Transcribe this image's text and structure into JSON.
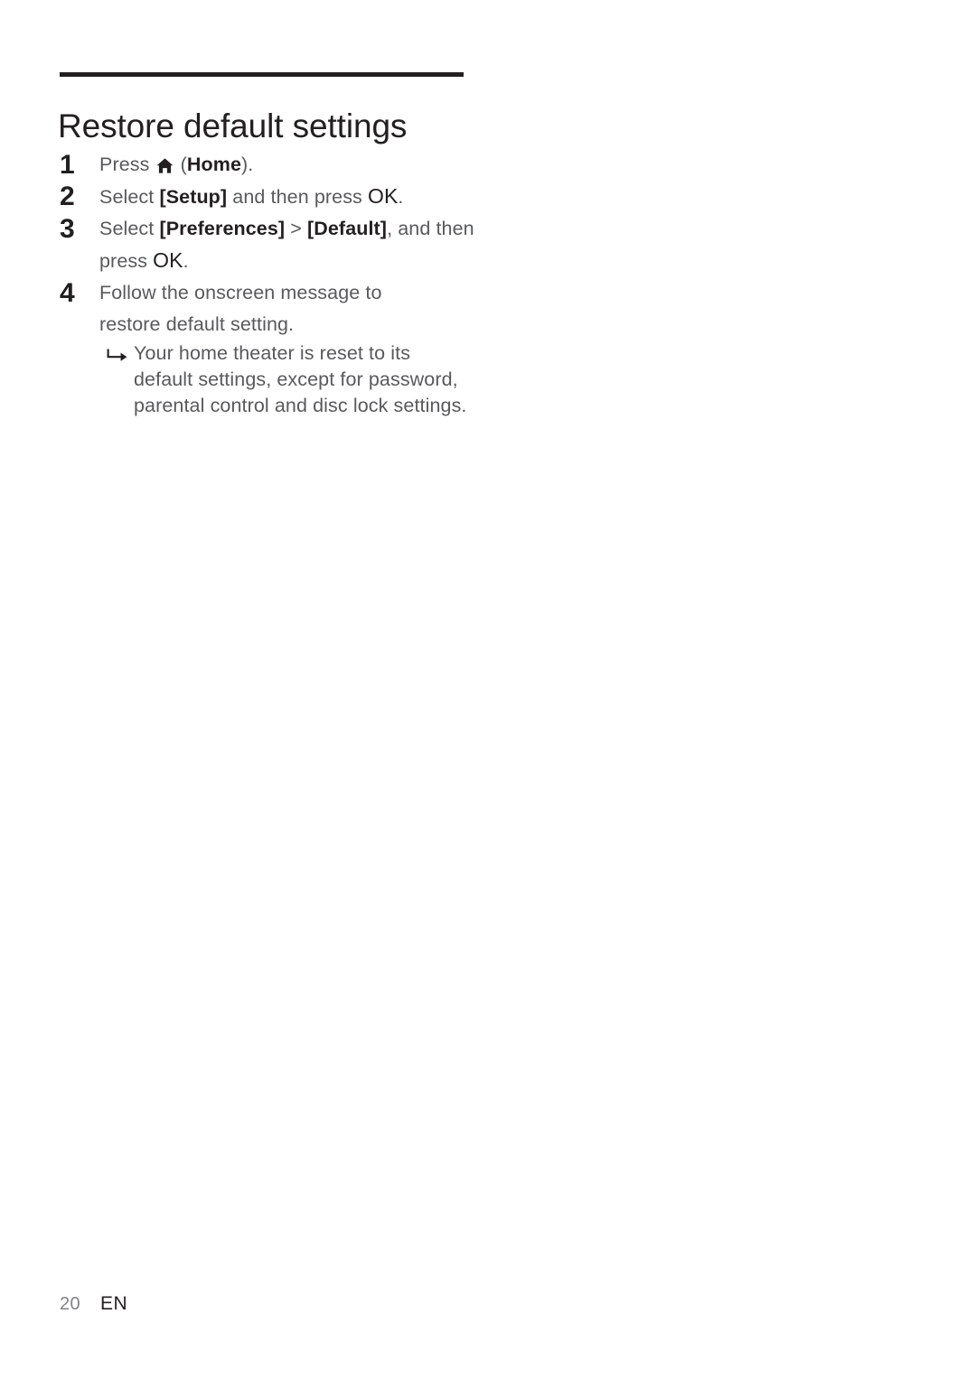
{
  "document": {
    "section_title": "Restore default settings",
    "rule_color": "#231f20",
    "body_color": "#58595b",
    "emphasis_color": "#231f20"
  },
  "steps": [
    {
      "number": "1",
      "text_before_icon": "Press ",
      "icon": "home-icon",
      "text_after_icon_plain_1": " (",
      "emphasis": "Home",
      "text_after_icon_plain_2": ")."
    },
    {
      "number": "2",
      "part1": "Select ",
      "bracket1": "[Setup]",
      "part2": " and then press ",
      "ok": "OK",
      "part3": "."
    },
    {
      "number": "3",
      "part1": "Select ",
      "bracket1": "[Preferences]",
      "part2": " > ",
      "bracket2": "[Default]",
      "part3": ", and then press ",
      "ok": "OK",
      "part4": "."
    },
    {
      "number": "4",
      "text": "Follow the onscreen message to restore default setting."
    }
  ],
  "result_note": {
    "arrow": "result-arrow-icon",
    "text": "Your home theater is reset to its default settings, except for password, parental control and disc lock settings."
  },
  "footer": {
    "page_number": "20",
    "language": "EN"
  }
}
